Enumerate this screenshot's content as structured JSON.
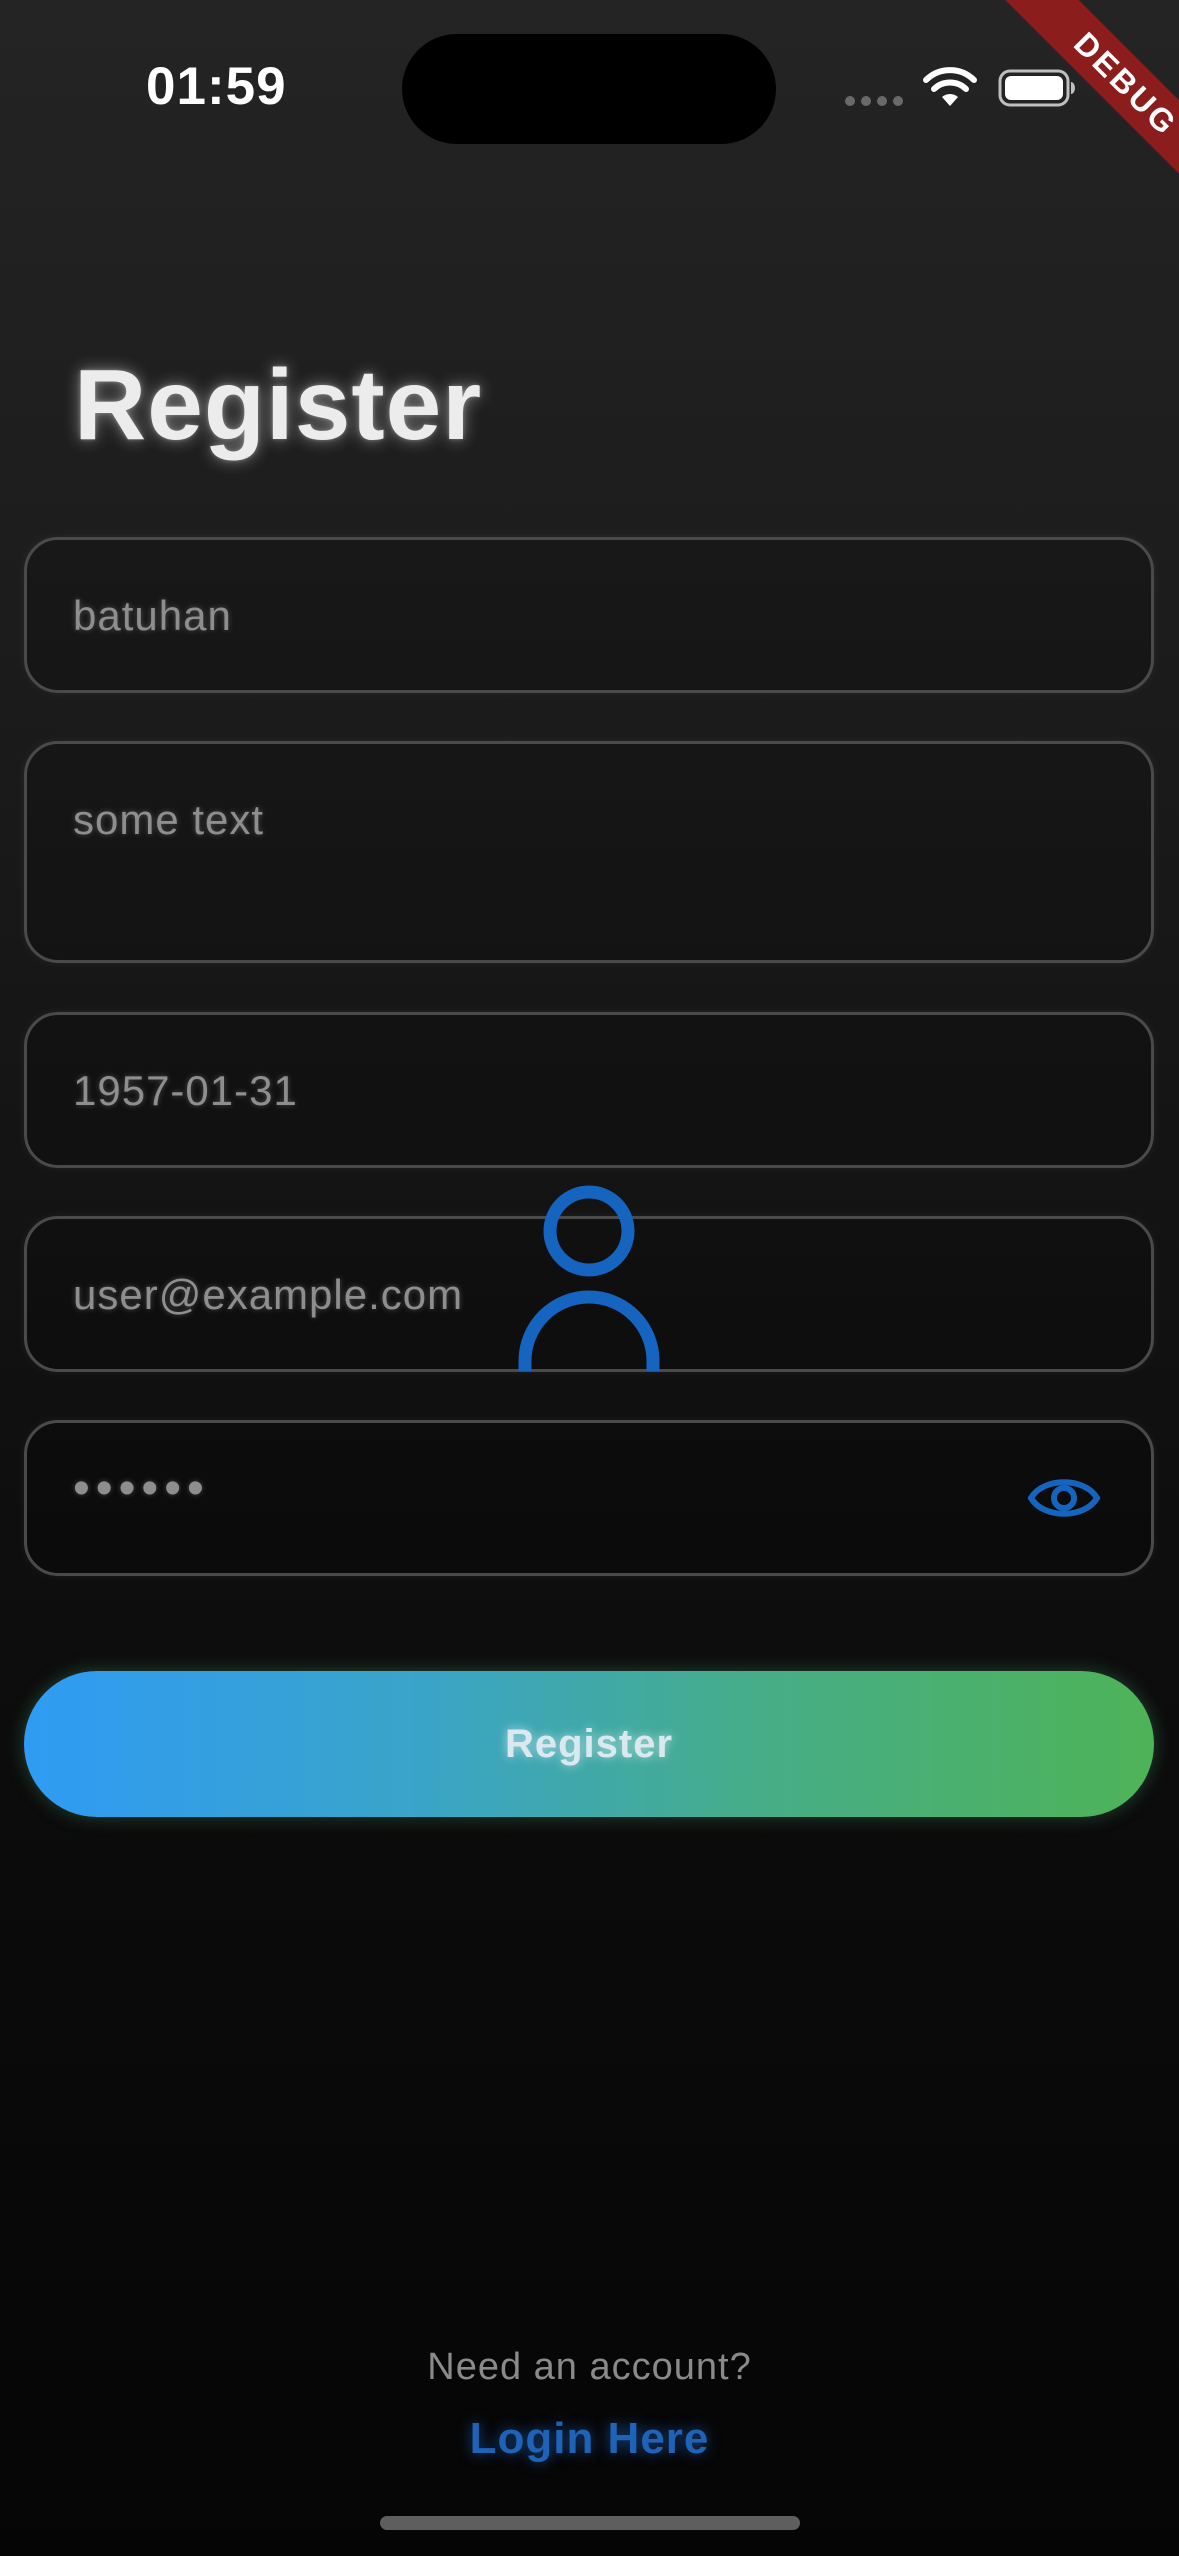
{
  "status_bar": {
    "time": "01:59"
  },
  "debug_banner": "DEBUG",
  "title": "Register",
  "form": {
    "username_value": "batuhan",
    "bio_value": "some text",
    "birthdate_value": "1957-01-31",
    "email_value": "user@example.com",
    "password_value": "••••••"
  },
  "register_button_label": "Register",
  "footer": {
    "prompt": "Need an account?",
    "link": "Login Here"
  },
  "colors": {
    "accent_blue": "#1565C0",
    "gradient_start": "#2196F3",
    "gradient_end": "#4CAF50",
    "debug_red": "#8B1D1D"
  },
  "icons": {
    "password_toggle": "eye-icon",
    "loading_avatar": "person-icon"
  }
}
